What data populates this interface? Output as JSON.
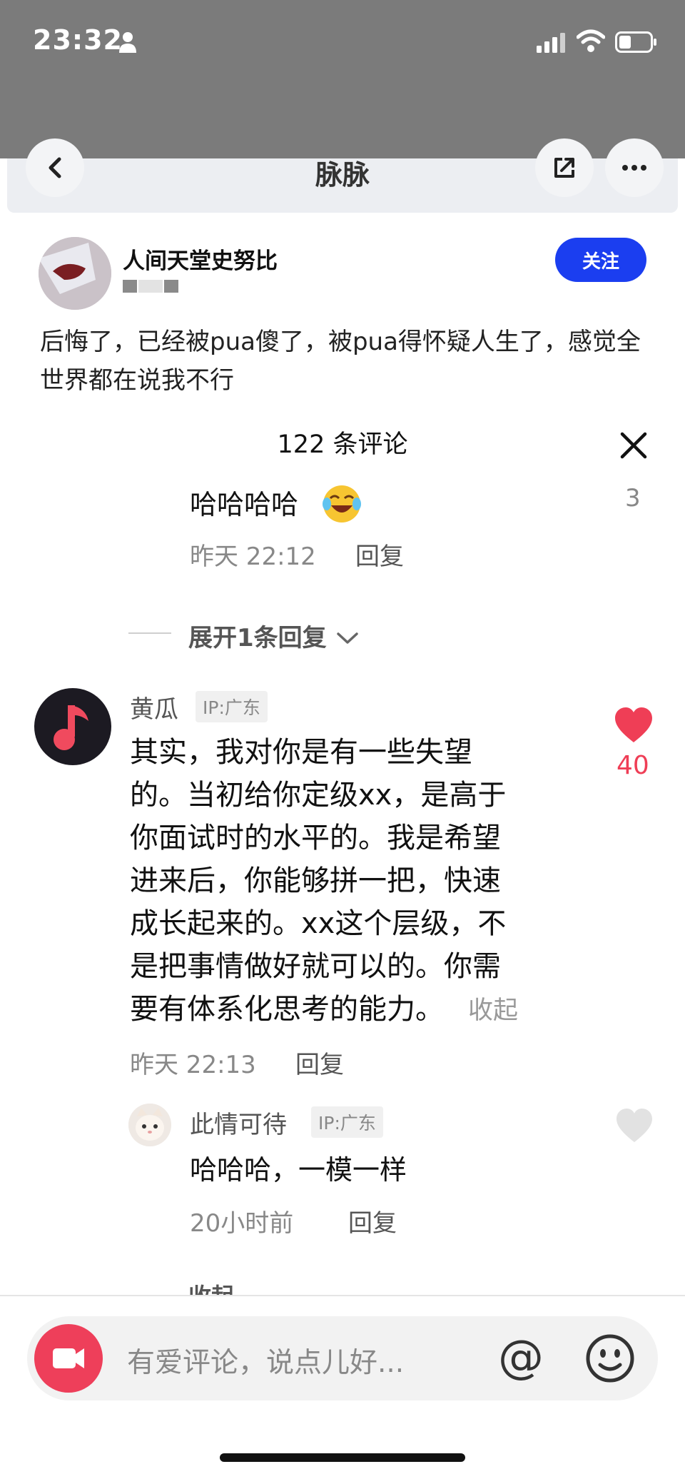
{
  "status_bar": {
    "time": "23:32"
  },
  "nav": {
    "title": "脉脉"
  },
  "post": {
    "author": "人间天堂史努比",
    "follow_label": "关注",
    "text": "后悔了，已经被pua傻了，被pua得怀疑人生了，感觉全世界都在说我不行"
  },
  "comments_header": {
    "count_label": "122 条评论"
  },
  "prev_reply": {
    "text": "哈哈哈哈",
    "likes": "3",
    "time": "昨天 22:12",
    "reply_label": "回复",
    "expand_label": "展开1条回复"
  },
  "comment": {
    "user": "黄瓜",
    "ip": "IP:广东",
    "lines": [
      "其实，我对你是有一些失望",
      "的。当初给你定级xx，是高于",
      "你面试时的水平的。我是希望",
      "进来后，你能够拼一把，快速",
      "成长起来的。xx这个层级，不",
      "是把事情做好就可以的。你需",
      "要有体系化思考的能力。"
    ],
    "collapse_inline": "收起",
    "likes": "40",
    "like_color": "#ef3e56",
    "time": "昨天 22:13",
    "reply_label": "回复"
  },
  "sub_reply": {
    "user": "此情可待",
    "ip": "IP:广东",
    "text": "哈哈哈，一模一样",
    "time": "20小时前",
    "reply_label": "回复",
    "collapse_label": "收起"
  },
  "input_bar": {
    "placeholder": "有爱评论，说点儿好...",
    "at_symbol": "@"
  },
  "colors": {
    "accent_blue": "#1b3ef0",
    "accent_red": "#ee3f5a"
  }
}
